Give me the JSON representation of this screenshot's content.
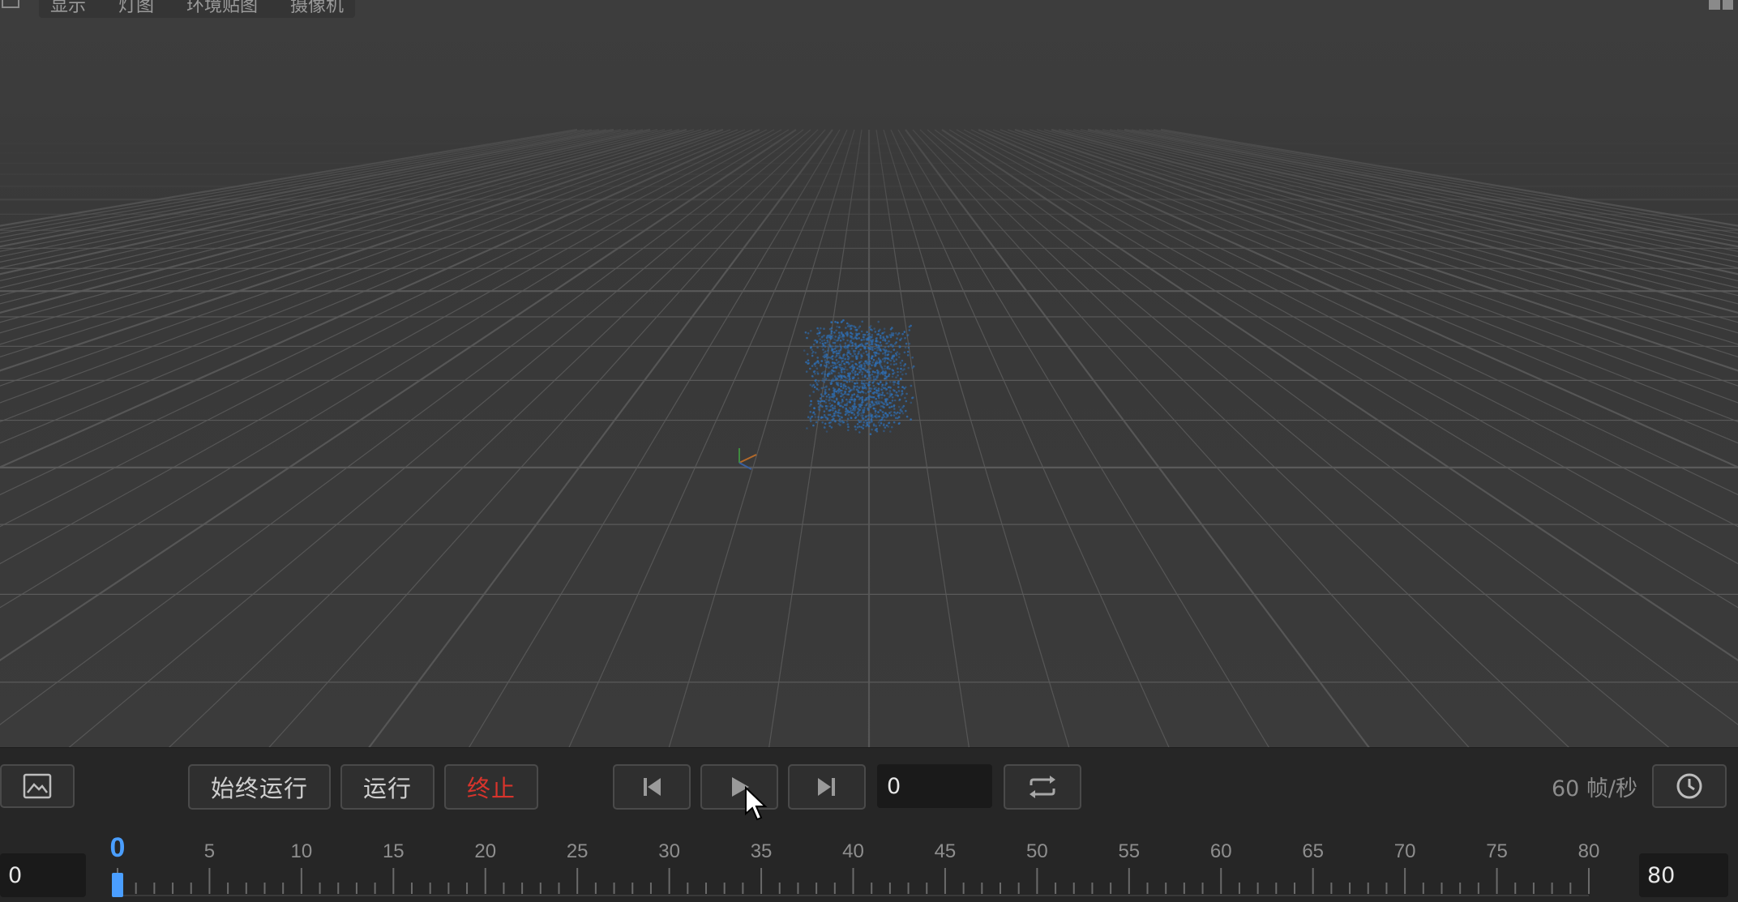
{
  "viewport": {
    "menu": [
      "显示",
      "灯图",
      "环境贴图",
      "摄像机"
    ],
    "icons": {
      "corner": "viewport-frame-icon",
      "layout": "layout-icon"
    },
    "colors": {
      "particles": "#2e6fb5",
      "grid": "#5a5a5a"
    }
  },
  "playback": {
    "snapshot_icon": "image-icon",
    "always_run_label": "始终运行",
    "run_label": "运行",
    "stop_label": "终止",
    "stop_color": "#d8342c",
    "frame_value": "0",
    "fps_label": "60 帧/秒",
    "icons": {
      "first_frame": "skip-to-start-icon",
      "play": "play-icon",
      "last_frame": "skip-to-end-icon",
      "loop": "loop-icon",
      "speed": "clock-icon"
    }
  },
  "timeline": {
    "current_frame": "0",
    "current_frame_value": 0,
    "start": 0,
    "end": 80,
    "tick_labels": [
      "5",
      "10",
      "15",
      "20",
      "25",
      "30",
      "35",
      "40",
      "45",
      "50",
      "55",
      "60",
      "65",
      "70",
      "75",
      "80"
    ],
    "range_start": "0",
    "range_end": "80",
    "accent_color": "#4a9eff"
  }
}
